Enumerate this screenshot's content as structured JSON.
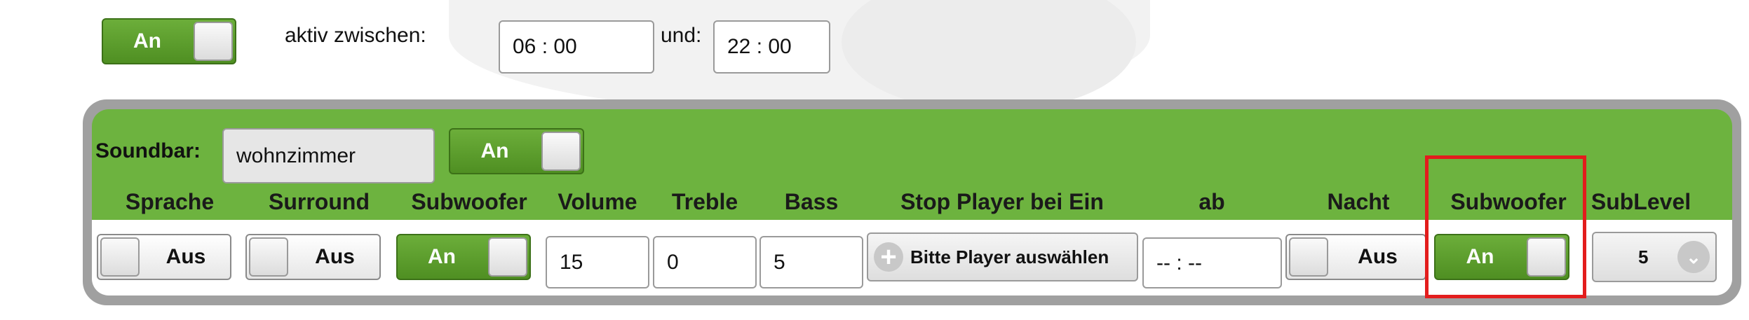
{
  "top": {
    "toggle_label": "An",
    "active_between_label": "aktiv zwischen:",
    "start_time": "06 : 00",
    "and_label": "und:",
    "end_time": "22 : 00"
  },
  "soundbar": {
    "label": "Soundbar:",
    "name": "wohnzimmer",
    "toggle_label": "An"
  },
  "columns": {
    "sprache": "Sprache",
    "surround": "Surround",
    "subwoofer": "Subwoofer",
    "volume": "Volume",
    "treble": "Treble",
    "bass": "Bass",
    "stop_player": "Stop Player bei Ein",
    "ab": "ab",
    "nacht": "Nacht",
    "subwoofer2": "Subwoofer",
    "sublevel": "SubLevel"
  },
  "row": {
    "sprache": "Aus",
    "surround": "Aus",
    "subwoofer": "An",
    "volume": "15",
    "treble": "0",
    "bass": "5",
    "stop_player_button": "Bitte Player auswählen",
    "ab_time": "-- : --",
    "nacht": "Aus",
    "subwoofer2": "An",
    "sublevel": "5"
  },
  "colors": {
    "green": "#6db33f",
    "highlight": "#e31d1d"
  }
}
